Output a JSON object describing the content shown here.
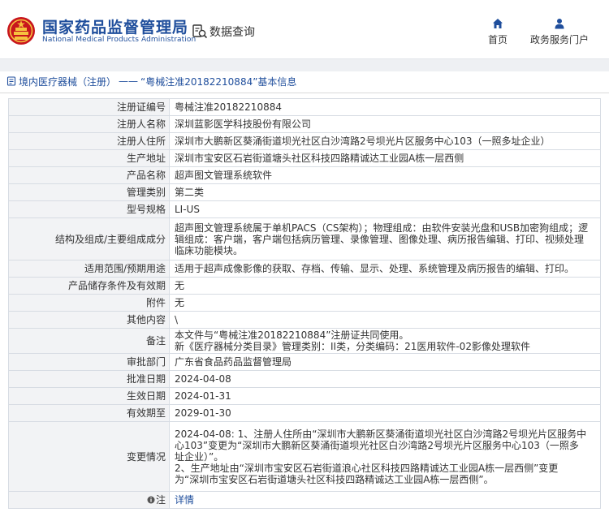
{
  "header": {
    "brand_cn": "国家药品监督管理局",
    "brand_en": "National Medical Products Administration",
    "search_label": "数据查询",
    "nav": {
      "home": "首页",
      "portal": "政务服务门户"
    },
    "brand_color": "#1f4e9c"
  },
  "breadcrumb": {
    "category": "境内医疗器械（注册）",
    "separator": "——",
    "title": "“粤械注准20182210884”基本信息"
  },
  "rows": [
    {
      "label": "注册证编号",
      "value": "粤械注准20182210884"
    },
    {
      "label": "注册人名称",
      "value": "深圳蓝影医学科技股份有限公司"
    },
    {
      "label": "注册人住所",
      "value": "深圳市大鹏新区葵涌街道坝光社区白沙湾路2号坝光片区服务中心103（一照多址企业）"
    },
    {
      "label": "生产地址",
      "value": "深圳市宝安区石岩街道塘头社区科技四路精诚达工业园A栋一层西侧"
    },
    {
      "label": "产品名称",
      "value": "超声图文管理系统软件"
    },
    {
      "label": "管理类别",
      "value": "第二类"
    },
    {
      "label": "型号规格",
      "value": "LI-US"
    },
    {
      "label": "结构及组成/主要组成成分",
      "value_lines": [
        "超声图文管理系统属于单机PACS（CS架构）；物理组成：由软件安装光盘和USB加密狗组成；逻",
        "辑组成：客户端，客户端包括病历管理、录像管理、图像处理、病历报告编辑、打印、视频处理",
        "临床功能模块。"
      ]
    },
    {
      "label": "适用范围/预期用途",
      "value": "适用于超声成像影像的获取、存档、传输、显示、处理、系统管理及病历报告的编辑、打印。"
    },
    {
      "label": "产品储存条件及有效期",
      "value": "无"
    },
    {
      "label": "附件",
      "value": "无"
    },
    {
      "label": "其他内容",
      "value": "\\"
    },
    {
      "label": "备注",
      "value_lines": [
        "本文件与“粤械注准20182210884”注册证共同使用。",
        "新《医疗器械分类目录》管理类别：II类，分类编码：21医用软件-02影像处理软件"
      ]
    },
    {
      "label": "审批部门",
      "value": "广东省食品药品监督管理局"
    },
    {
      "label": "批准日期",
      "value": "2024-04-08"
    },
    {
      "label": "生效日期",
      "value": "2024-01-31"
    },
    {
      "label": "有效期至",
      "value": "2029-01-30"
    },
    {
      "label": "变更情况",
      "value_lines": [
        "2024-04-08: 1、注册人住所由“深圳市大鹏新区葵涌街道坝光社区白沙湾路2号坝光片区服务中",
        "心103”变更为“深圳市大鹏新区葵涌街道坝光社区白沙湾路2号坝光片区服务中心103（一照多",
        "址企业）”。",
        "2、生产地址由“深圳市宝安区石岩街道浪心社区科技四路精诚达工业园A栋一层西侧”变更",
        "为“深圳市宝安区石岩街道塘头社区科技四路精诚达工业园A栋一层西侧”。"
      ]
    },
    {
      "label": "注",
      "value": "详情"
    }
  ]
}
